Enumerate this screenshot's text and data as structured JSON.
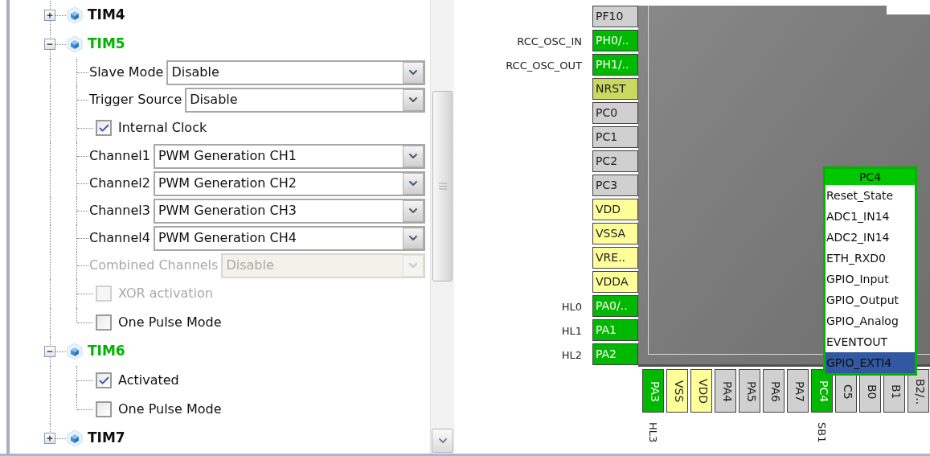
{
  "tree": [
    {
      "label": "TIM4",
      "expanded": false,
      "active": false
    },
    {
      "label": "TIM5",
      "expanded": true,
      "active": true,
      "children": [
        {
          "kind": "dropdown",
          "label": "Slave Mode",
          "value": "Disable",
          "disabled": false
        },
        {
          "kind": "dropdown",
          "label": "Trigger Source",
          "value": "Disable",
          "disabled": false
        },
        {
          "kind": "checkbox",
          "label": "Internal Clock",
          "checked": true,
          "disabled": false
        },
        {
          "kind": "dropdown",
          "label": "Channel1",
          "value": "PWM Generation CH1",
          "disabled": false
        },
        {
          "kind": "dropdown",
          "label": "Channel2",
          "value": "PWM Generation CH2",
          "disabled": false
        },
        {
          "kind": "dropdown",
          "label": "Channel3",
          "value": "PWM Generation CH3",
          "disabled": false
        },
        {
          "kind": "dropdown",
          "label": "Channel4",
          "value": "PWM Generation CH4",
          "disabled": false
        },
        {
          "kind": "dropdown",
          "label": "Combined Channels",
          "value": "Disable",
          "disabled": true
        },
        {
          "kind": "checkbox",
          "label": "XOR activation",
          "checked": false,
          "disabled": true
        },
        {
          "kind": "checkbox",
          "label": "One Pulse Mode",
          "checked": false,
          "disabled": false
        }
      ]
    },
    {
      "label": "TIM6",
      "expanded": true,
      "active": true,
      "children": [
        {
          "kind": "checkbox",
          "label": "Activated",
          "checked": true,
          "disabled": false
        },
        {
          "kind": "checkbox",
          "label": "One Pulse Mode",
          "checked": false,
          "disabled": false
        }
      ]
    },
    {
      "label": "TIM7",
      "expanded": false,
      "active": false
    }
  ],
  "pinout": {
    "left_pins": [
      {
        "name": "PF10",
        "kind": "free"
      },
      {
        "name": "PH0/..",
        "kind": "assigned",
        "label": "RCC_OSC_IN"
      },
      {
        "name": "PH1/..",
        "kind": "assigned",
        "label": "RCC_OSC_OUT"
      },
      {
        "name": "NRST",
        "kind": "reset"
      },
      {
        "name": "PC0",
        "kind": "free"
      },
      {
        "name": "PC1",
        "kind": "free"
      },
      {
        "name": "PC2",
        "kind": "free"
      },
      {
        "name": "PC3",
        "kind": "free"
      },
      {
        "name": "VDD",
        "kind": "power"
      },
      {
        "name": "VSSA",
        "kind": "power"
      },
      {
        "name": "VRE..",
        "kind": "power"
      },
      {
        "name": "VDDA",
        "kind": "power"
      },
      {
        "name": "PA0/..",
        "kind": "assigned",
        "label": "HL0"
      },
      {
        "name": "PA1",
        "kind": "assigned",
        "label": "HL1"
      },
      {
        "name": "PA2",
        "kind": "assigned",
        "label": "HL2"
      }
    ],
    "bottom_pins": [
      {
        "name": "PA3",
        "kind": "assigned",
        "label": "HL3"
      },
      {
        "name": "VSS",
        "kind": "power"
      },
      {
        "name": "VDD",
        "kind": "power"
      },
      {
        "name": "PA4",
        "kind": "free"
      },
      {
        "name": "PA5",
        "kind": "free"
      },
      {
        "name": "PA6",
        "kind": "free"
      },
      {
        "name": "PA7",
        "kind": "free"
      },
      {
        "name": "PC4",
        "kind": "assigned",
        "label": "SB1"
      },
      {
        "name": "C5",
        "kind": "free"
      },
      {
        "name": "B0",
        "kind": "free"
      },
      {
        "name": "B1",
        "kind": "free"
      },
      {
        "name": "B2/..",
        "kind": "free"
      }
    ],
    "popup": {
      "title": "PC4",
      "items": [
        {
          "label": "Reset_State",
          "selected": false
        },
        {
          "label": "ADC1_IN14",
          "selected": false
        },
        {
          "label": "ADC2_IN14",
          "selected": false
        },
        {
          "label": "ETH_RXD0",
          "selected": false
        },
        {
          "label": "GPIO_Input",
          "selected": false
        },
        {
          "label": "GPIO_Output",
          "selected": false
        },
        {
          "label": "GPIO_Analog",
          "selected": false
        },
        {
          "label": "EVENTOUT",
          "selected": false
        },
        {
          "label": "GPIO_EXTI4",
          "selected": true
        }
      ]
    }
  }
}
